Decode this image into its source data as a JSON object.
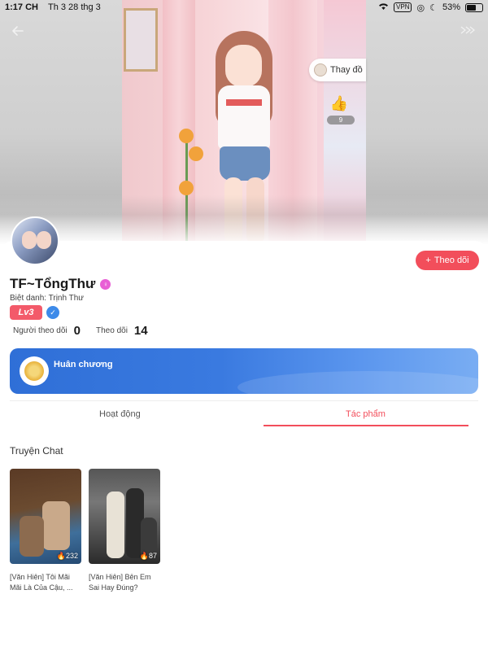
{
  "status_bar": {
    "time": "1:17 CH",
    "date": "Th 3 28 thg 3",
    "vpn": "VPN",
    "battery": "53%"
  },
  "banner": {
    "outfit_label": "Thay đồ",
    "like_count": "9"
  },
  "profile": {
    "name": "TF~TổngThư",
    "nickname_label": "Biệt danh: Trịnh Thư",
    "level": "Lv3",
    "follow_button": "Theo dõi",
    "follow_plus": "+",
    "stats": [
      {
        "label": "Người theo dõi",
        "value": "0"
      },
      {
        "label": "Theo dõi",
        "value": "14"
      }
    ]
  },
  "medal": {
    "title": "Huân chương"
  },
  "tabs": [
    {
      "label": "Hoạt động",
      "active": false
    },
    {
      "label": "Tác phẩm",
      "active": true
    }
  ],
  "section": {
    "title": "Truyện Chat"
  },
  "works": [
    {
      "title": "[Văn Hiên] Tôi Mãi Mãi Là Của Cậu, ...",
      "views": "232"
    },
    {
      "title": "[Văn Hiên] Bên Em Sai Hay Đúng?",
      "views": "87"
    }
  ],
  "colors": {
    "accent": "#f24e5b",
    "medal_blue": "#2f6fd7",
    "level_badge": "#f35a6a"
  }
}
